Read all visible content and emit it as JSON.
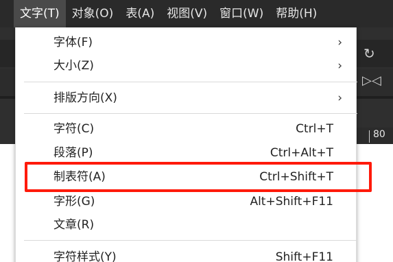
{
  "menubar": {
    "items": [
      {
        "label": "文字(T)"
      },
      {
        "label": "对象(O)"
      },
      {
        "label": "表(A)"
      },
      {
        "label": "视图(V)"
      },
      {
        "label": "窗口(W)"
      },
      {
        "label": "帮助(H)"
      }
    ]
  },
  "ruler": {
    "label": "80"
  },
  "menu": {
    "items": [
      {
        "label": "字体(F)",
        "shortcut": "",
        "has_submenu": true
      },
      {
        "label": "大小(Z)",
        "shortcut": "",
        "has_submenu": true
      },
      {
        "label": "排版方向(X)",
        "shortcut": "",
        "has_submenu": true
      },
      {
        "label": "字符(C)",
        "shortcut": "Ctrl+T",
        "has_submenu": false
      },
      {
        "label": "段落(P)",
        "shortcut": "Ctrl+Alt+T",
        "has_submenu": false
      },
      {
        "label": "制表符(A)",
        "shortcut": "Ctrl+Shift+T",
        "has_submenu": false,
        "highlighted": true
      },
      {
        "label": "字形(G)",
        "shortcut": "Alt+Shift+F11",
        "has_submenu": false
      },
      {
        "label": "文章(R)",
        "shortcut": "",
        "has_submenu": false
      },
      {
        "label": "字符样式(Y)",
        "shortcut": "Shift+F11",
        "has_submenu": false
      }
    ],
    "submenu_arrow": "›"
  },
  "colors": {
    "highlight_border": "#ff1a0a",
    "menubar_bg": "#2a2a2a",
    "menu_bg": "#ffffff"
  }
}
